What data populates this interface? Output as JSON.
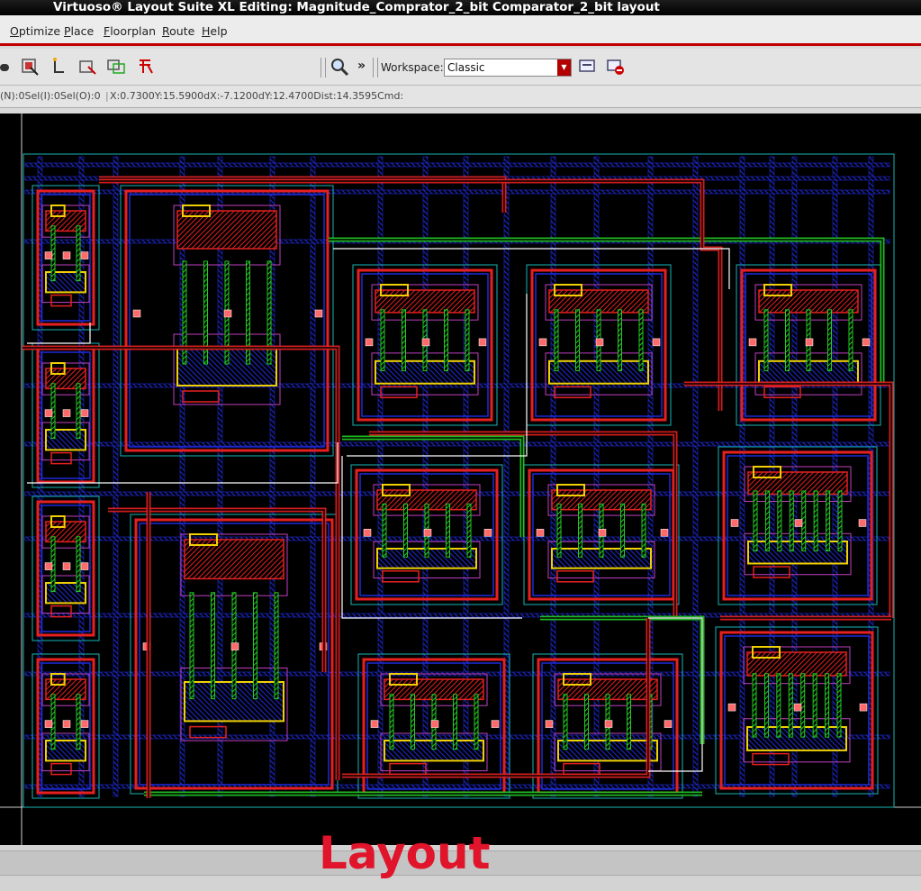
{
  "window": {
    "title": "Virtuoso® Layout Suite XL Editing: Magnitude_Comprator_2_bit Comparator_2_bit layout"
  },
  "menu": {
    "items": [
      "Optimize",
      "Place",
      "Floorplan",
      "Route",
      "Help"
    ]
  },
  "toolbar": {
    "workspace_label": "Workspace:",
    "workspace_value": "Classic",
    "more_label": "»",
    "tools": [
      "select-icon",
      "route-icon",
      "stretch-icon",
      "move-icon",
      "copy-icon",
      "zoom-icon",
      "workspace-save-icon",
      "workspace-delete-icon"
    ]
  },
  "status": {
    "selection": "(N):0Sel(I):0Sel(O):0",
    "coords": "X:0.7300Y:15.5900dX:-7.1200dY:12.4700Dist:14.3595Cmd:"
  },
  "caption": "Layout",
  "colors": {
    "metal1": "#1e2bd8",
    "metal2": "#e62020",
    "poly": "#22cc22",
    "nwell": "#19b4b4",
    "diff": "#f0d000",
    "implant": "#c040c0",
    "accent": "#c00000"
  }
}
